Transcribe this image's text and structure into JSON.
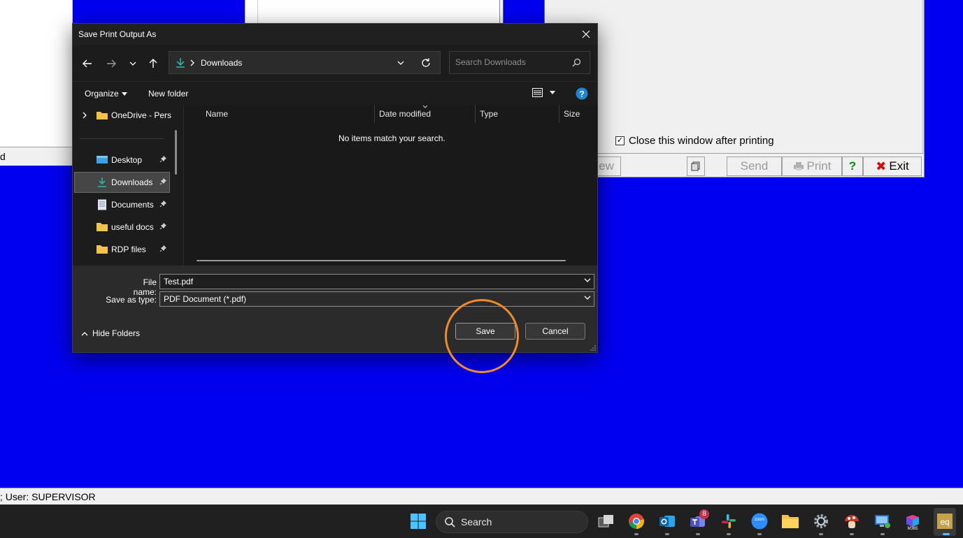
{
  "background_app": {
    "left_fragment": "d",
    "close_after_print_label": "Close this window after printing",
    "close_after_print_checked": true,
    "buttons": {
      "view_fragment": "ew",
      "send": "Send",
      "print": "Print",
      "help": "?",
      "exit": "Exit"
    },
    "status_text": "; User: SUPERVISOR"
  },
  "dialog": {
    "title": "Save Print Output As",
    "address": {
      "location": "Downloads"
    },
    "search": {
      "placeholder": "Search Downloads"
    },
    "command_bar": {
      "organize": "Organize",
      "new_folder": "New folder"
    },
    "nav_pane": {
      "items": [
        {
          "label": "OneDrive - Personal",
          "icon": "cloud-folder-icon"
        },
        {
          "label": "Desktop",
          "icon": "desktop-icon",
          "pinned": true
        },
        {
          "label": "Downloads",
          "icon": "download-icon",
          "pinned": true,
          "selected": true
        },
        {
          "label": "Documents",
          "icon": "document-icon",
          "pinned": true
        },
        {
          "label": "useful docs",
          "icon": "folder-icon",
          "pinned": true
        },
        {
          "label": "RDP files",
          "icon": "folder-icon",
          "pinned": true
        }
      ]
    },
    "columns": [
      "Name",
      "Date modified",
      "Type",
      "Size"
    ],
    "empty_message": "No items match your search.",
    "file_name_label": "File name:",
    "file_name_value": "Test.pdf",
    "save_as_type_label": "Save as type:",
    "save_as_type_value": "PDF Document (*.pdf)",
    "hide_folders": "Hide Folders",
    "save_button": "Save",
    "cancel_button": "Cancel"
  },
  "taskbar": {
    "search_label": "Search",
    "teams_badge": "8",
    "zoom_label": "zoom",
    "m365_label": "M365"
  },
  "colors": {
    "desktop_blue": "#0000f0",
    "dialog_bg": "#202020",
    "highlight": "#f08a2a",
    "accent_teal": "#2bb3a3"
  }
}
